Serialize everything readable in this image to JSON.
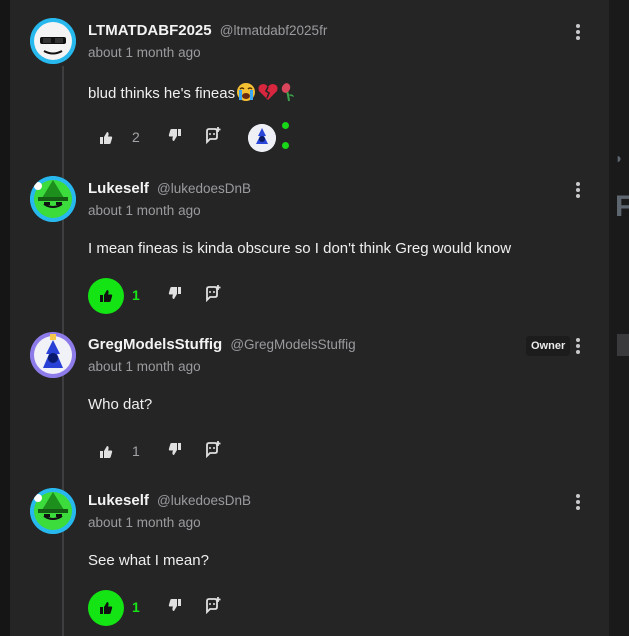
{
  "colors": {
    "panel": "#252526",
    "accent_green": "#14e414",
    "muted_text": "#9b9b9f"
  },
  "comments": [
    {
      "author": "LTMATDABF2025",
      "handle": "@ltmatdabf2025fr",
      "time": "about 1 month ago",
      "body": "blud thinks he's fineas",
      "body_emojis": [
        "loudly-crying-face",
        "broken-heart",
        "wilted-flower"
      ],
      "likes": "2",
      "liked": false,
      "owner_badge": "",
      "avatar_icon": "white-cat-sunglasses-avatar",
      "extra": "user-avatar-thumbnail-with-green-dots"
    },
    {
      "author": "Lukeself",
      "handle": "@lukedoesDnB",
      "time": "about 1 month ago",
      "body": "I mean fineas is kinda obscure so I don't think Greg would know",
      "likes": "1",
      "liked": true,
      "owner_badge": "",
      "avatar_icon": "green-witch-avatar"
    },
    {
      "author": "GregModelsStuffig",
      "handle": "@GregModelsStuffig",
      "time": "about 1 month ago",
      "body": "Who dat?",
      "likes": "1",
      "liked": false,
      "owner_badge": "Owner",
      "avatar_icon": "blue-flame-figure-avatar"
    },
    {
      "author": "Lukeself",
      "handle": "@lukedoesDnB",
      "time": "about 1 month ago",
      "body": "See what I mean?",
      "likes": "1",
      "liked": true,
      "owner_badge": "",
      "avatar_icon": "green-witch-avatar"
    }
  ]
}
